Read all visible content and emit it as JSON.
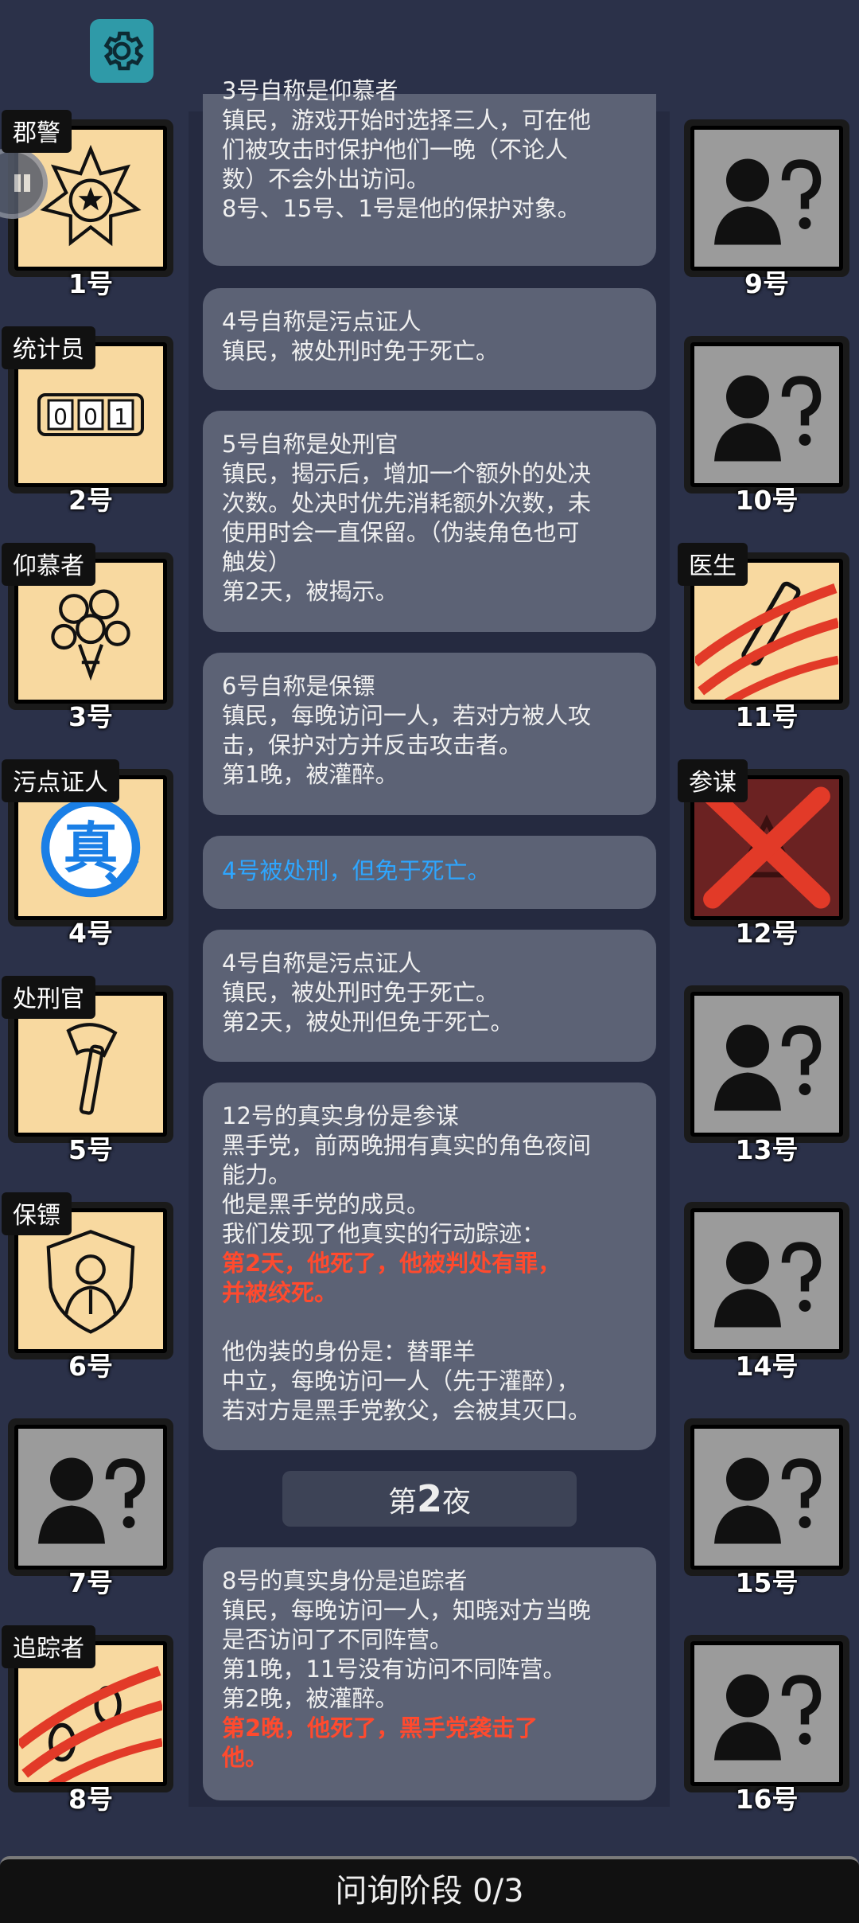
{
  "players_left": [
    {
      "num": "1号",
      "role": "郡警",
      "icon": "sheriff-badge-icon",
      "tile": "yellow"
    },
    {
      "num": "2号",
      "role": "统计员",
      "icon": "counter-001-icon",
      "tile": "yellow"
    },
    {
      "num": "3号",
      "role": "仰慕者",
      "icon": "rose-bouquet-icon",
      "tile": "yellow"
    },
    {
      "num": "4号",
      "role": "污点证人",
      "icon": "true-stamp-icon",
      "tile": "yellow",
      "stamp": "真"
    },
    {
      "num": "5号",
      "role": "处刑官",
      "icon": "axe-icon",
      "tile": "yellow"
    },
    {
      "num": "6号",
      "role": "保镖",
      "icon": "bodyguard-shield-icon",
      "tile": "yellow"
    },
    {
      "num": "7号",
      "role": "",
      "icon": "unknown-person-icon",
      "tile": "gray"
    },
    {
      "num": "8号",
      "role": "追踪者",
      "icon": "footprints-slashed-icon",
      "tile": "yellow"
    }
  ],
  "players_right": [
    {
      "num": "9号",
      "role": "",
      "icon": "unknown-person-icon",
      "tile": "gray"
    },
    {
      "num": "10号",
      "role": "",
      "icon": "unknown-person-icon",
      "tile": "gray"
    },
    {
      "num": "11号",
      "role": "医生",
      "icon": "syringe-slashed-icon",
      "tile": "yellow"
    },
    {
      "num": "12号",
      "role": "参谋",
      "icon": "crossed-out-icon",
      "tile": "dark"
    },
    {
      "num": "13号",
      "role": "",
      "icon": "unknown-person-icon",
      "tile": "gray"
    },
    {
      "num": "14号",
      "role": "",
      "icon": "unknown-person-icon",
      "tile": "gray"
    },
    {
      "num": "15号",
      "role": "",
      "icon": "unknown-person-icon",
      "tile": "gray"
    },
    {
      "num": "16号",
      "role": "",
      "icon": "unknown-person-icon",
      "tile": "gray"
    }
  ],
  "messages": {
    "m1": {
      "l1": "3号自称是仰慕者",
      "l2": "镇民，游戏开始时选择三人，可在他",
      "l3": "们被攻击时保护他们一晚（不论人",
      "l4": "数）不会外出访问。",
      "l5": "8号、15号、1号是他的保护对象。"
    },
    "m2": {
      "l1": "4号自称是污点证人",
      "l2": "镇民，被处刑时免于死亡。"
    },
    "m3": {
      "l1": "5号自称是处刑官",
      "l2": "镇民，揭示后，增加一个额外的处决",
      "l3": "次数。处决时优先消耗额外次数，未",
      "l4": "使用时会一直保留。（伪装角色也可",
      "l5": "触发）",
      "l6": "第2天，被揭示。"
    },
    "m4": {
      "l1": "6号自称是保镖",
      "l2": "镇民，每晚访问一人，若对方被人攻",
      "l3": "击，保护对方并反击攻击者。",
      "l4": "第1晚，被灌醉。"
    },
    "m5": {
      "l1": "4号被处刑，但免于死亡。"
    },
    "m6": {
      "l1": "4号自称是污点证人",
      "l2": "镇民，被处刑时免于死亡。",
      "l3": "第2天，被处刑但免于死亡。"
    },
    "m7": {
      "l1": "12号的真实身份是参谋",
      "l2": "黑手党，前两晚拥有真实的角色夜间",
      "l3": "能力。",
      "l4": "他是黑手党的成员。",
      "l5": "我们发现了他真实的行动踪迹：",
      "l6": "第2天，他死了，他被判处有罪，",
      "l7": "并被绞死。",
      "l8": "他伪装的身份是：替罪羊",
      "l9": "中立，每晚访问一人（先于灌醉），",
      "l10": "若对方是黑手党教父，会被其灭口。"
    },
    "m8": {
      "l1": "8号的真实身份是追踪者",
      "l2": "镇民，每晚访问一人，知晓对方当晚",
      "l3": "是否访问了不同阵营。",
      "l4": "第1晚，11号没有访问不同阵营。",
      "l5": "第2晚，被灌醉。",
      "l6": "第2晚，他死了，黑手党袭击了",
      "l7": "他。"
    }
  },
  "night_label": {
    "prefix": "第",
    "num": "2",
    "suffix": "夜"
  },
  "bottom_bar": {
    "label": "问询阶段 0/3"
  },
  "colors": {
    "background": "#2b3149",
    "feed": "#252a40",
    "bubble": "#5c6275",
    "highlight_red": "#ff4a2e",
    "highlight_blue": "#2ea6ff",
    "tile_yellow": "#f8d9a0",
    "tile_gray": "#9b9b9b"
  }
}
